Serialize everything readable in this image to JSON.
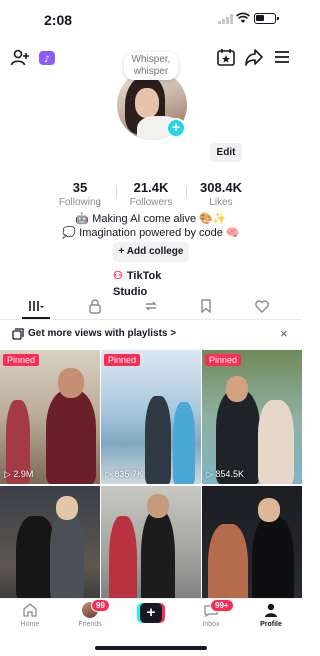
{
  "status": {
    "time": "2:08"
  },
  "profile": {
    "note": "Whisper, whisper",
    "edit_label": "Edit",
    "stats": [
      {
        "value": "35",
        "label": "Following"
      },
      {
        "value": "21.4K",
        "label": "Followers"
      },
      {
        "value": "308.4K",
        "label": "Likes"
      }
    ],
    "bio_line1": "🤖 Making AI come alive 🎨✨",
    "bio_line2": "💭 Imagination powered by code 🧠",
    "add_college_label": "+ Add college",
    "studio_label": "TikTok Studio"
  },
  "playlist_banner": {
    "text": "Get more views with playlists >",
    "close": "×"
  },
  "videos": [
    {
      "pinned": "Pinned",
      "views": "▷ 2.9M"
    },
    {
      "pinned": "Pinned",
      "views": "▷ 835.7K"
    },
    {
      "pinned": "Pinned",
      "views": "▷ 854.5K"
    },
    {
      "pinned": "",
      "views": ""
    },
    {
      "pinned": "",
      "views": ""
    },
    {
      "pinned": "",
      "views": ""
    }
  ],
  "nav": {
    "home": "Home",
    "friends": "Friends",
    "friends_badge": "99",
    "inbox": "Inbox",
    "inbox_badge": "99+",
    "profile": "Profile"
  }
}
